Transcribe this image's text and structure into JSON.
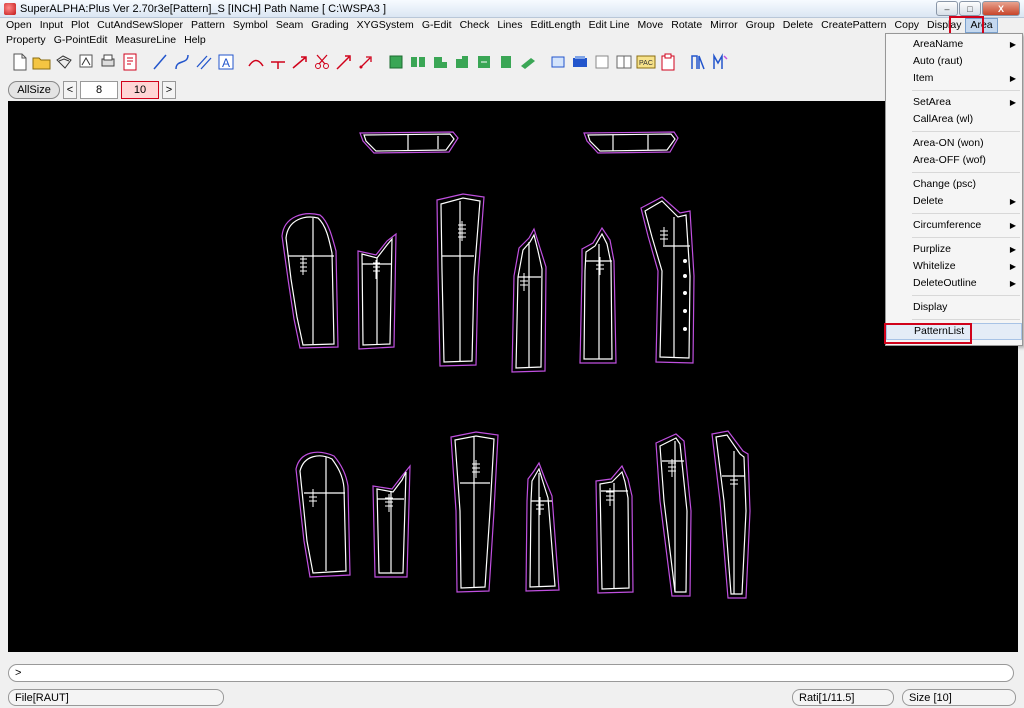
{
  "window": {
    "title": "SuperALPHA:Plus Ver 2.70r3e[Pattern]_S [INCH]  Path Name  [ C:\\WSPA3 ]",
    "minimize": "–",
    "restore": "□",
    "close": "X"
  },
  "menu_row1": [
    "Open",
    "Input",
    "Plot",
    "CutAndSewSloper",
    "Pattern",
    "Symbol",
    "Seam",
    "Grading",
    "XYGSystem",
    "G-Edit",
    "Check",
    "Lines",
    "EditLength",
    "Edit Line",
    "Move",
    "Rotate",
    "Mirror",
    "Group",
    "Delete",
    "CreatePattern",
    "Copy",
    "Display",
    "Area"
  ],
  "menu_row2": [
    "Property",
    "G-PointEdit",
    "MeasureLine",
    "Help"
  ],
  "size_bar": {
    "all_size": "AllSize",
    "prev": "<",
    "next": ">",
    "sizes": [
      "8",
      "10"
    ]
  },
  "area_menu": {
    "items": [
      {
        "label": "AreaName",
        "submenu": true
      },
      {
        "label": "Auto  (raut)",
        "submenu": false
      },
      {
        "label": "Item",
        "submenu": true
      },
      {
        "sep": true
      },
      {
        "label": "SetArea",
        "submenu": true
      },
      {
        "label": "CallArea  (wl)",
        "submenu": false
      },
      {
        "sep": true
      },
      {
        "label": "Area-ON  (won)",
        "submenu": false
      },
      {
        "label": "Area-OFF  (wof)",
        "submenu": false
      },
      {
        "sep": true
      },
      {
        "label": "Change  (psc)",
        "submenu": false
      },
      {
        "label": "Delete",
        "submenu": true
      },
      {
        "sep": true
      },
      {
        "label": "Circumference",
        "submenu": true
      },
      {
        "sep": true
      },
      {
        "label": "Purplize",
        "submenu": true
      },
      {
        "label": "Whitelize",
        "submenu": true
      },
      {
        "label": "DeleteOutline",
        "submenu": true
      },
      {
        "sep": true
      },
      {
        "label": "Display",
        "submenu": false
      },
      {
        "sep": true
      },
      {
        "label": "PatternList",
        "submenu": false
      }
    ]
  },
  "command_line": {
    "prompt": ">"
  },
  "status": {
    "file": "File[RAUT]",
    "ratio": "Rati[1/11.5]",
    "size": "Size [10]"
  },
  "colors": {
    "highlight": "#d0021b",
    "outline_purple": "#c050e0",
    "pattern_white": "#ffffff",
    "canvas": "#000000"
  }
}
